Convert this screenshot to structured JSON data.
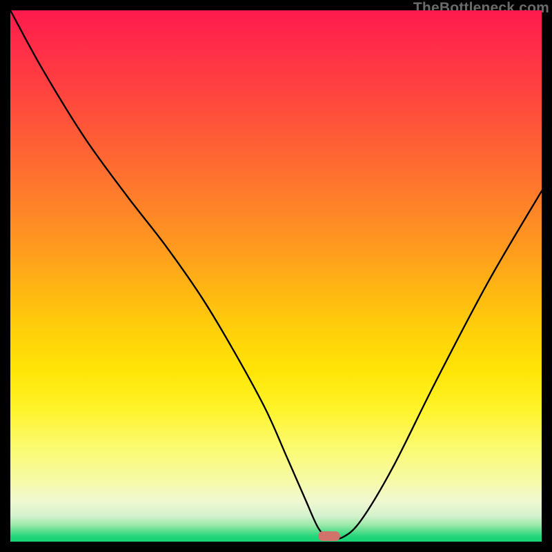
{
  "watermark": "TheBottleneck.com",
  "marker": {
    "x_pct": 60.0,
    "y_pct": 99.0,
    "color": "#d1736b"
  },
  "chart_data": {
    "type": "line",
    "title": "",
    "xlabel": "",
    "ylabel": "",
    "xlim": [
      0,
      100
    ],
    "ylim": [
      0,
      100
    ],
    "series": [
      {
        "name": "bottleneck-curve",
        "x": [
          0,
          6,
          14,
          22,
          29,
          36,
          42,
          48,
          52,
          55.5,
          58,
          60,
          62.5,
          66,
          72,
          80,
          90,
          100
        ],
        "y": [
          100,
          89,
          76,
          65,
          56,
          46,
          36,
          25,
          16,
          8,
          2.5,
          0.8,
          0.8,
          4,
          14,
          30,
          49,
          66
        ]
      }
    ],
    "background_gradient_stops": [
      {
        "pct": 0,
        "color": "#ff1a4d"
      },
      {
        "pct": 24,
        "color": "#ff5c36"
      },
      {
        "pct": 52,
        "color": "#ffb414"
      },
      {
        "pct": 75,
        "color": "#fff32a"
      },
      {
        "pct": 93,
        "color": "#f0f8d2"
      },
      {
        "pct": 100,
        "color": "#17d374"
      }
    ],
    "annotations": [
      {
        "type": "marker",
        "x": 60.0,
        "y": 0.8,
        "shape": "pill",
        "color": "#d1736b"
      }
    ]
  }
}
